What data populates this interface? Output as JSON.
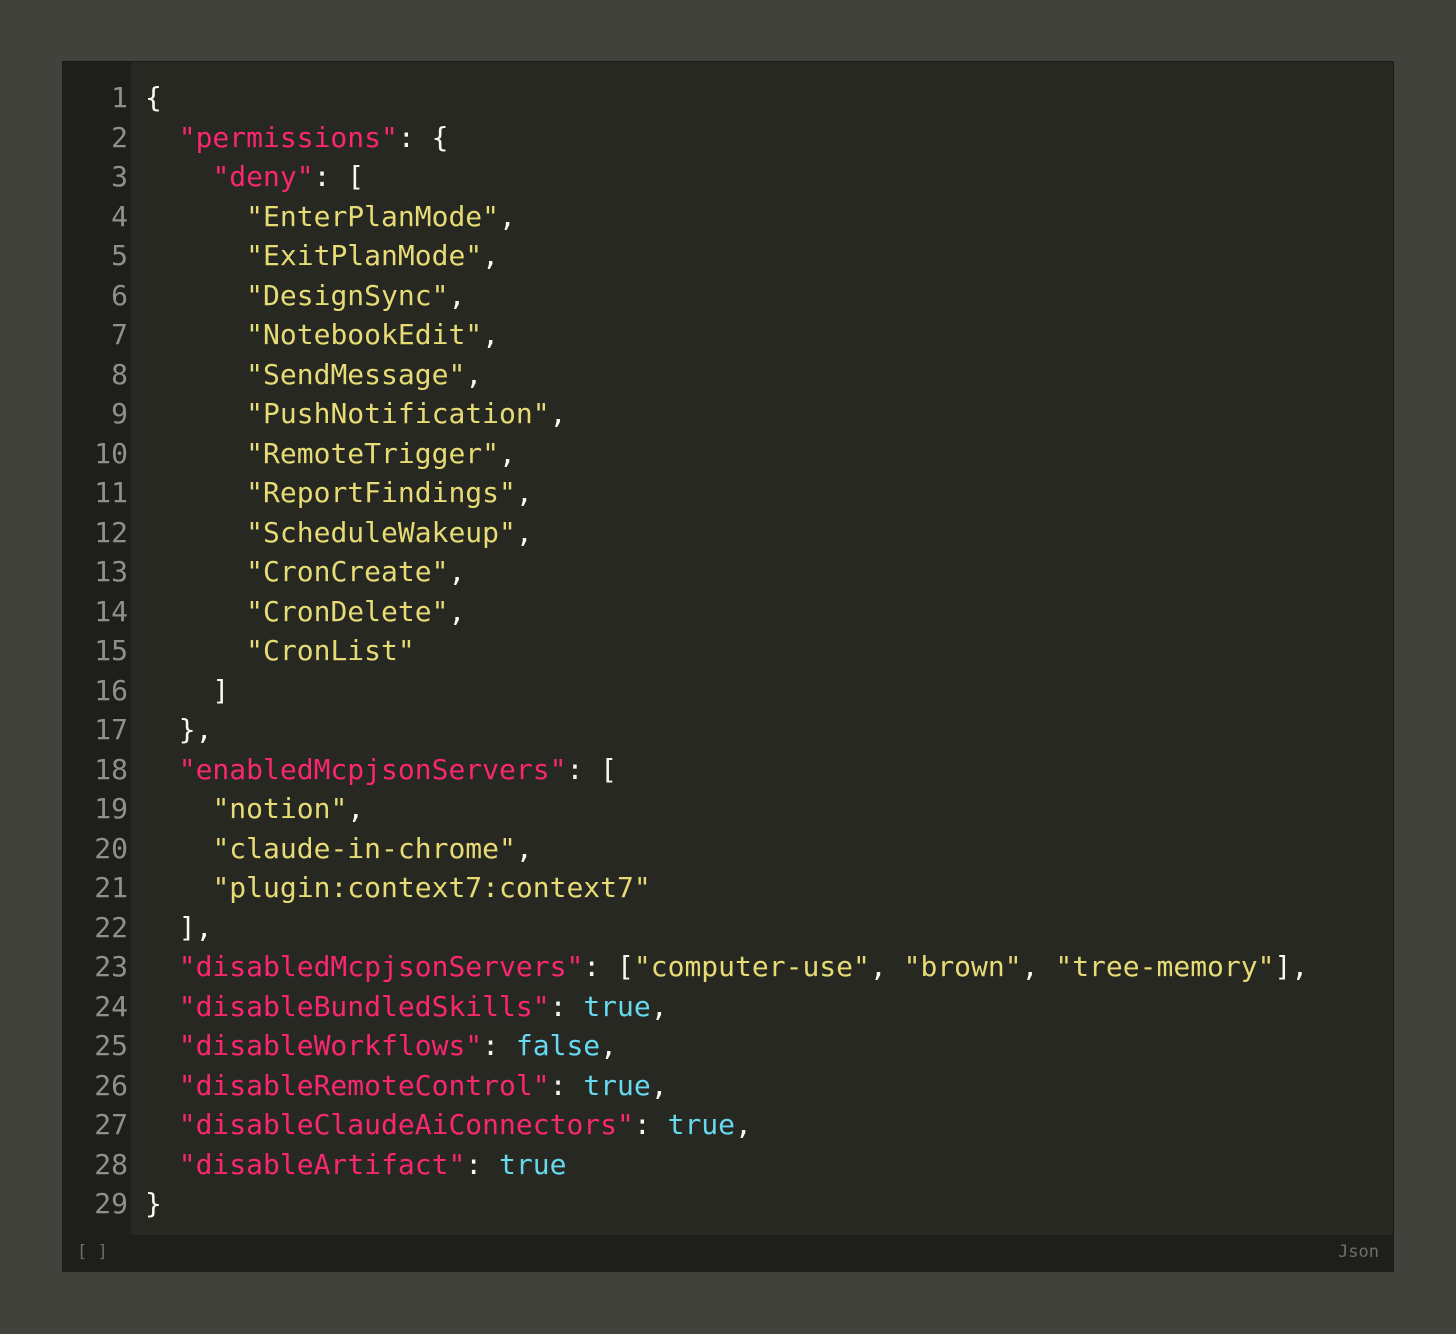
{
  "editor": {
    "language": "Json",
    "bracket_indicator": "[ ]",
    "line_numbers": [
      "1",
      "2",
      "3",
      "4",
      "5",
      "6",
      "7",
      "8",
      "9",
      "10",
      "11",
      "12",
      "13",
      "14",
      "15",
      "16",
      "17",
      "18",
      "19",
      "20",
      "21",
      "22",
      "23",
      "24",
      "25",
      "26",
      "27",
      "28",
      "29"
    ],
    "lines": [
      [
        {
          "t": "p",
          "v": "{"
        }
      ],
      [
        {
          "t": "p",
          "v": "  "
        },
        {
          "t": "k",
          "v": "\"permissions\""
        },
        {
          "t": "p",
          "v": ": {"
        }
      ],
      [
        {
          "t": "p",
          "v": "    "
        },
        {
          "t": "k",
          "v": "\"deny\""
        },
        {
          "t": "p",
          "v": ": ["
        }
      ],
      [
        {
          "t": "p",
          "v": "      "
        },
        {
          "t": "s",
          "v": "\"EnterPlanMode\""
        },
        {
          "t": "p",
          "v": ","
        }
      ],
      [
        {
          "t": "p",
          "v": "      "
        },
        {
          "t": "s",
          "v": "\"ExitPlanMode\""
        },
        {
          "t": "p",
          "v": ","
        }
      ],
      [
        {
          "t": "p",
          "v": "      "
        },
        {
          "t": "s",
          "v": "\"DesignSync\""
        },
        {
          "t": "p",
          "v": ","
        }
      ],
      [
        {
          "t": "p",
          "v": "      "
        },
        {
          "t": "s",
          "v": "\"NotebookEdit\""
        },
        {
          "t": "p",
          "v": ","
        }
      ],
      [
        {
          "t": "p",
          "v": "      "
        },
        {
          "t": "s",
          "v": "\"SendMessage\""
        },
        {
          "t": "p",
          "v": ","
        }
      ],
      [
        {
          "t": "p",
          "v": "      "
        },
        {
          "t": "s",
          "v": "\"PushNotification\""
        },
        {
          "t": "p",
          "v": ","
        }
      ],
      [
        {
          "t": "p",
          "v": "      "
        },
        {
          "t": "s",
          "v": "\"RemoteTrigger\""
        },
        {
          "t": "p",
          "v": ","
        }
      ],
      [
        {
          "t": "p",
          "v": "      "
        },
        {
          "t": "s",
          "v": "\"ReportFindings\""
        },
        {
          "t": "p",
          "v": ","
        }
      ],
      [
        {
          "t": "p",
          "v": "      "
        },
        {
          "t": "s",
          "v": "\"ScheduleWakeup\""
        },
        {
          "t": "p",
          "v": ","
        }
      ],
      [
        {
          "t": "p",
          "v": "      "
        },
        {
          "t": "s",
          "v": "\"CronCreate\""
        },
        {
          "t": "p",
          "v": ","
        }
      ],
      [
        {
          "t": "p",
          "v": "      "
        },
        {
          "t": "s",
          "v": "\"CronDelete\""
        },
        {
          "t": "p",
          "v": ","
        }
      ],
      [
        {
          "t": "p",
          "v": "      "
        },
        {
          "t": "s",
          "v": "\"CronList\""
        }
      ],
      [
        {
          "t": "p",
          "v": "    ]"
        }
      ],
      [
        {
          "t": "p",
          "v": "  },"
        }
      ],
      [
        {
          "t": "p",
          "v": "  "
        },
        {
          "t": "k",
          "v": "\"enabledMcpjsonServers\""
        },
        {
          "t": "p",
          "v": ": ["
        }
      ],
      [
        {
          "t": "p",
          "v": "    "
        },
        {
          "t": "s",
          "v": "\"notion\""
        },
        {
          "t": "p",
          "v": ","
        }
      ],
      [
        {
          "t": "p",
          "v": "    "
        },
        {
          "t": "s",
          "v": "\"claude-in-chrome\""
        },
        {
          "t": "p",
          "v": ","
        }
      ],
      [
        {
          "t": "p",
          "v": "    "
        },
        {
          "t": "s",
          "v": "\"plugin:context7:context7\""
        }
      ],
      [
        {
          "t": "p",
          "v": "  ],"
        }
      ],
      [
        {
          "t": "p",
          "v": "  "
        },
        {
          "t": "k",
          "v": "\"disabledMcpjsonServers\""
        },
        {
          "t": "p",
          "v": ": ["
        },
        {
          "t": "s",
          "v": "\"computer-use\""
        },
        {
          "t": "p",
          "v": ", "
        },
        {
          "t": "s",
          "v": "\"brown\""
        },
        {
          "t": "p",
          "v": ", "
        },
        {
          "t": "s",
          "v": "\"tree-memory\""
        },
        {
          "t": "p",
          "v": "],"
        }
      ],
      [
        {
          "t": "p",
          "v": "  "
        },
        {
          "t": "k",
          "v": "\"disableBundledSkills\""
        },
        {
          "t": "p",
          "v": ": "
        },
        {
          "t": "b",
          "v": "true"
        },
        {
          "t": "p",
          "v": ","
        }
      ],
      [
        {
          "t": "p",
          "v": "  "
        },
        {
          "t": "k",
          "v": "\"disableWorkflows\""
        },
        {
          "t": "p",
          "v": ": "
        },
        {
          "t": "b",
          "v": "false"
        },
        {
          "t": "p",
          "v": ","
        }
      ],
      [
        {
          "t": "p",
          "v": "  "
        },
        {
          "t": "k",
          "v": "\"disableRemoteControl\""
        },
        {
          "t": "p",
          "v": ": "
        },
        {
          "t": "b",
          "v": "true"
        },
        {
          "t": "p",
          "v": ","
        }
      ],
      [
        {
          "t": "p",
          "v": "  "
        },
        {
          "t": "k",
          "v": "\"disableClaudeAiConnectors\""
        },
        {
          "t": "p",
          "v": ": "
        },
        {
          "t": "b",
          "v": "true"
        },
        {
          "t": "p",
          "v": ","
        }
      ],
      [
        {
          "t": "p",
          "v": "  "
        },
        {
          "t": "k",
          "v": "\"disableArtifact\""
        },
        {
          "t": "p",
          "v": ": "
        },
        {
          "t": "b",
          "v": "true"
        }
      ],
      [
        {
          "t": "p",
          "v": "}"
        }
      ]
    ]
  },
  "colors": {
    "background": "#41423c",
    "editor_bg": "#272822",
    "gutter_bg": "#1e1f1b",
    "key": "#f92672",
    "string": "#e6db74",
    "boolean": "#66d9ef",
    "punctuation": "#f8f8f2",
    "line_number": "#8f908a"
  }
}
